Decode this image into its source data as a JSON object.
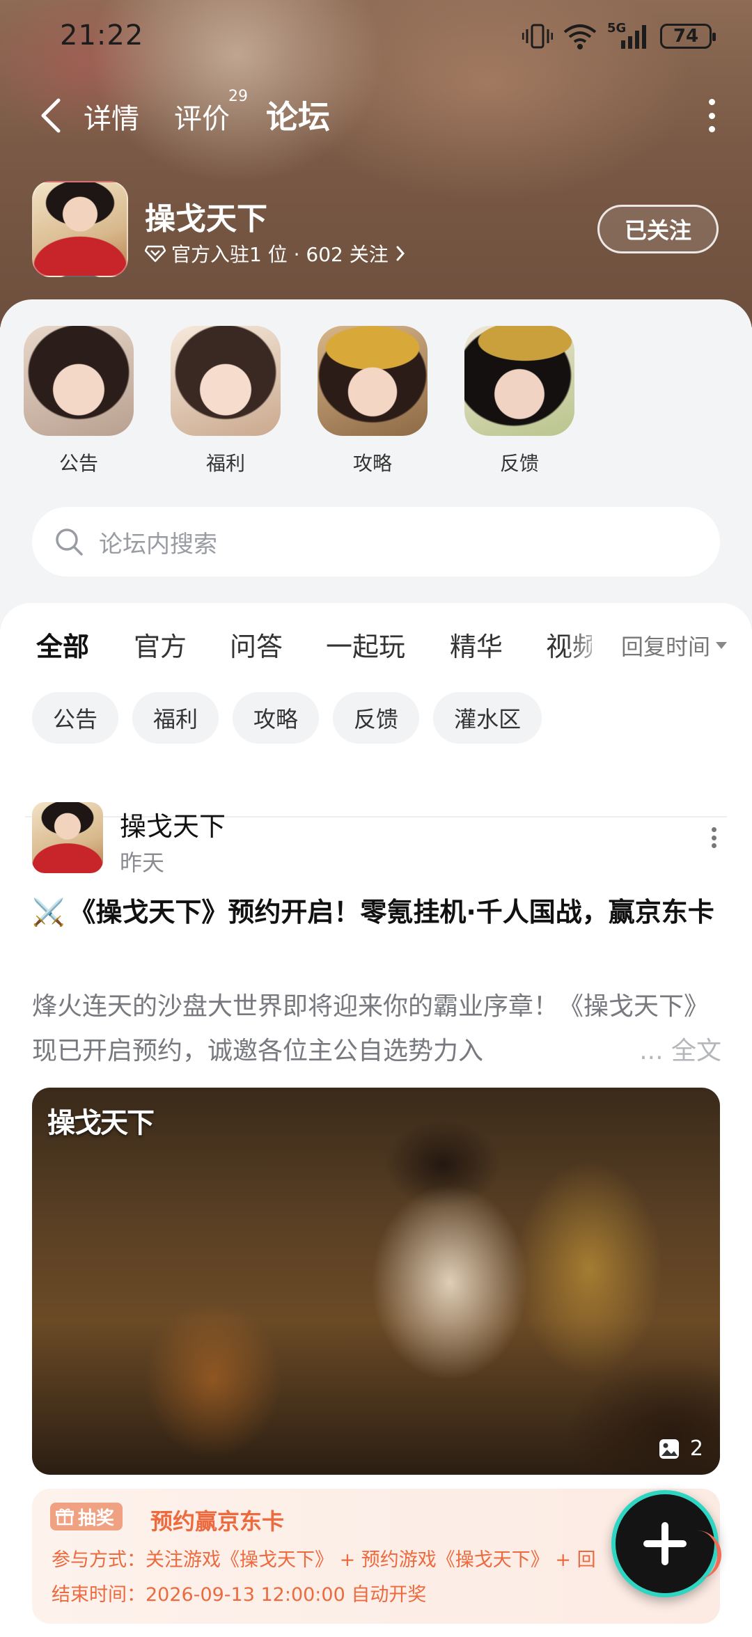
{
  "status_bar": {
    "time": "21:22",
    "network": "5G",
    "battery": "74"
  },
  "nav": {
    "tabs": [
      {
        "label": "详情"
      },
      {
        "label": "评价",
        "badge": "29"
      },
      {
        "label": "论坛",
        "active": true
      }
    ]
  },
  "app": {
    "name": "操戈天下",
    "meta": "官方入驻1 位 · 602 关注",
    "follow_label": "已关注"
  },
  "shortcuts": [
    {
      "label": "公告"
    },
    {
      "label": "福利"
    },
    {
      "label": "攻略"
    },
    {
      "label": "反馈"
    }
  ],
  "search": {
    "placeholder": "论坛内搜索"
  },
  "feed_tabs": [
    "全部",
    "官方",
    "问答",
    "一起玩",
    "精华",
    "视频"
  ],
  "sort_label": "回复时间",
  "chips": [
    "公告",
    "福利",
    "攻略",
    "反馈",
    "灌水区"
  ],
  "post": {
    "author": "操戈天下",
    "time": "昨天",
    "title_icon": "⚔️",
    "title": "《操戈天下》预约开启！零氪挂机·千人国战，赢京东卡",
    "body": "烽火连天的沙盘大世界即将迎来你的霸业序章！《操戈天下》现已开启预约，诚邀各位主公自选势力入",
    "read_more": "... 全文",
    "image_watermark": "操戈天下",
    "image_count": "2",
    "lottery": {
      "tag": "抽奖",
      "title": "预约赢京东卡",
      "method": "参与方式：关注游戏《操戈天下》 + 预约游戏《操戈天下》 + 回",
      "end": "结束时间：2026-09-13 12:00:00 自动开奖"
    }
  },
  "colors": {
    "accent": "#26d4c4",
    "lottery_orange": "#ec6a3e"
  }
}
